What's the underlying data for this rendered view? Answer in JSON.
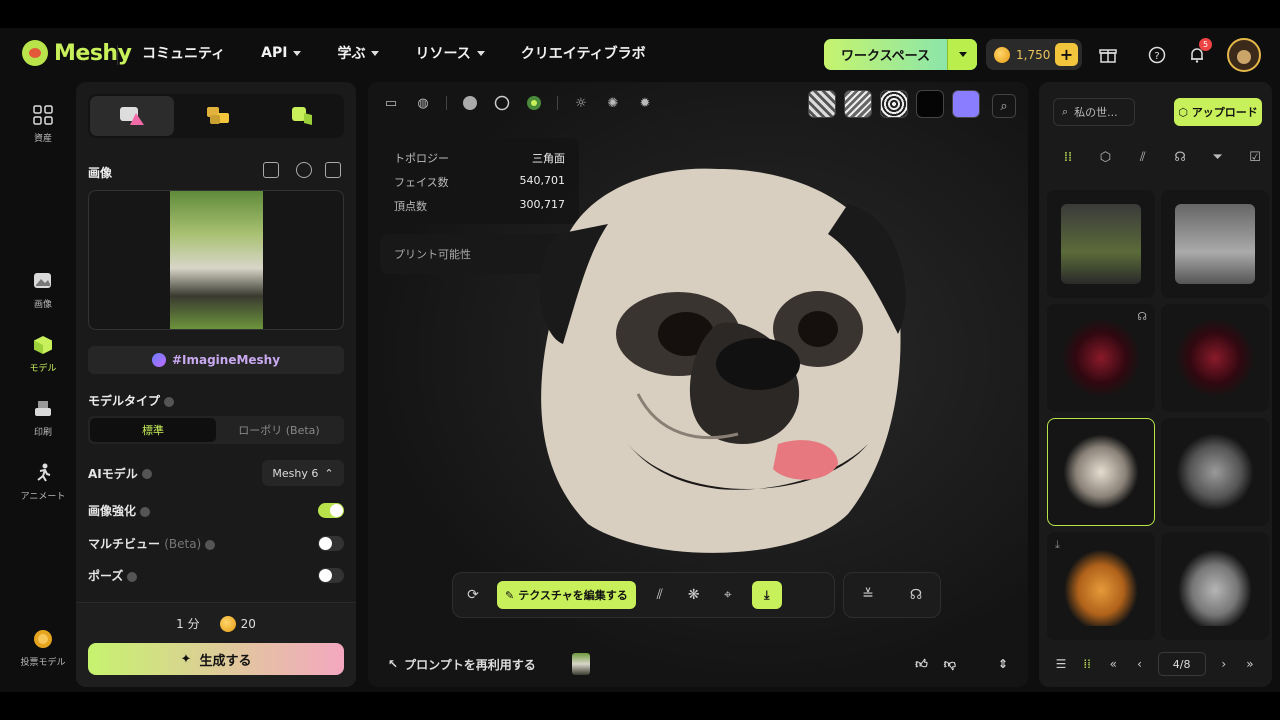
{
  "brand": {
    "name": "Meshy",
    "accent": "#c8f05a"
  },
  "nav": [
    {
      "label": "コミュニティ",
      "caret": false
    },
    {
      "label": "API",
      "caret": true
    },
    {
      "label": "学ぶ",
      "caret": true
    },
    {
      "label": "リソース",
      "caret": true
    },
    {
      "label": "クリエイティブラボ",
      "caret": false
    }
  ],
  "workspace": {
    "label": "ワークスペース"
  },
  "credits": {
    "value": "1,750"
  },
  "notifications": {
    "count": "5"
  },
  "rail": [
    {
      "label": "資産",
      "icon": "grid-icon"
    },
    {
      "label": "画像",
      "icon": "image-plus-icon"
    },
    {
      "label": "モデル",
      "icon": "cube-icon"
    },
    {
      "label": "印刷",
      "icon": "printer-icon"
    },
    {
      "label": "アニメート",
      "icon": "running-figure-icon"
    },
    {
      "label": "投票モデル",
      "icon": "coin-vote-icon"
    }
  ],
  "left_panel": {
    "image_label": "画像",
    "hashtag": "#ImagineMeshy",
    "model_type_label": "モデルタイプ",
    "model_type_options": [
      "標準",
      "ローポリ (Beta)"
    ],
    "ai_model_label": "AIモデル",
    "ai_model_value": "Meshy 6",
    "enhance_label": "画像強化",
    "multiview_label": "マルチビュー",
    "multiview_suffix": "(Beta)",
    "pose_label": "ポーズ",
    "time_cost": "1 分",
    "credit_cost": "20",
    "generate_label": "生成する"
  },
  "viewport": {
    "stats": [
      {
        "label": "トポロジー",
        "value": "三角面"
      },
      {
        "label": "フェイス数",
        "value": "540,701"
      },
      {
        "label": "頂点数",
        "value": "300,717"
      }
    ],
    "print_label": "プリント可能性",
    "texture_edit_label": "テクスチャを編集する",
    "reuse_label": "プロンプトを再利用する"
  },
  "right_panel": {
    "search_placeholder": "私の世...",
    "upload_label": "アップロード",
    "pagination": "4/8"
  }
}
